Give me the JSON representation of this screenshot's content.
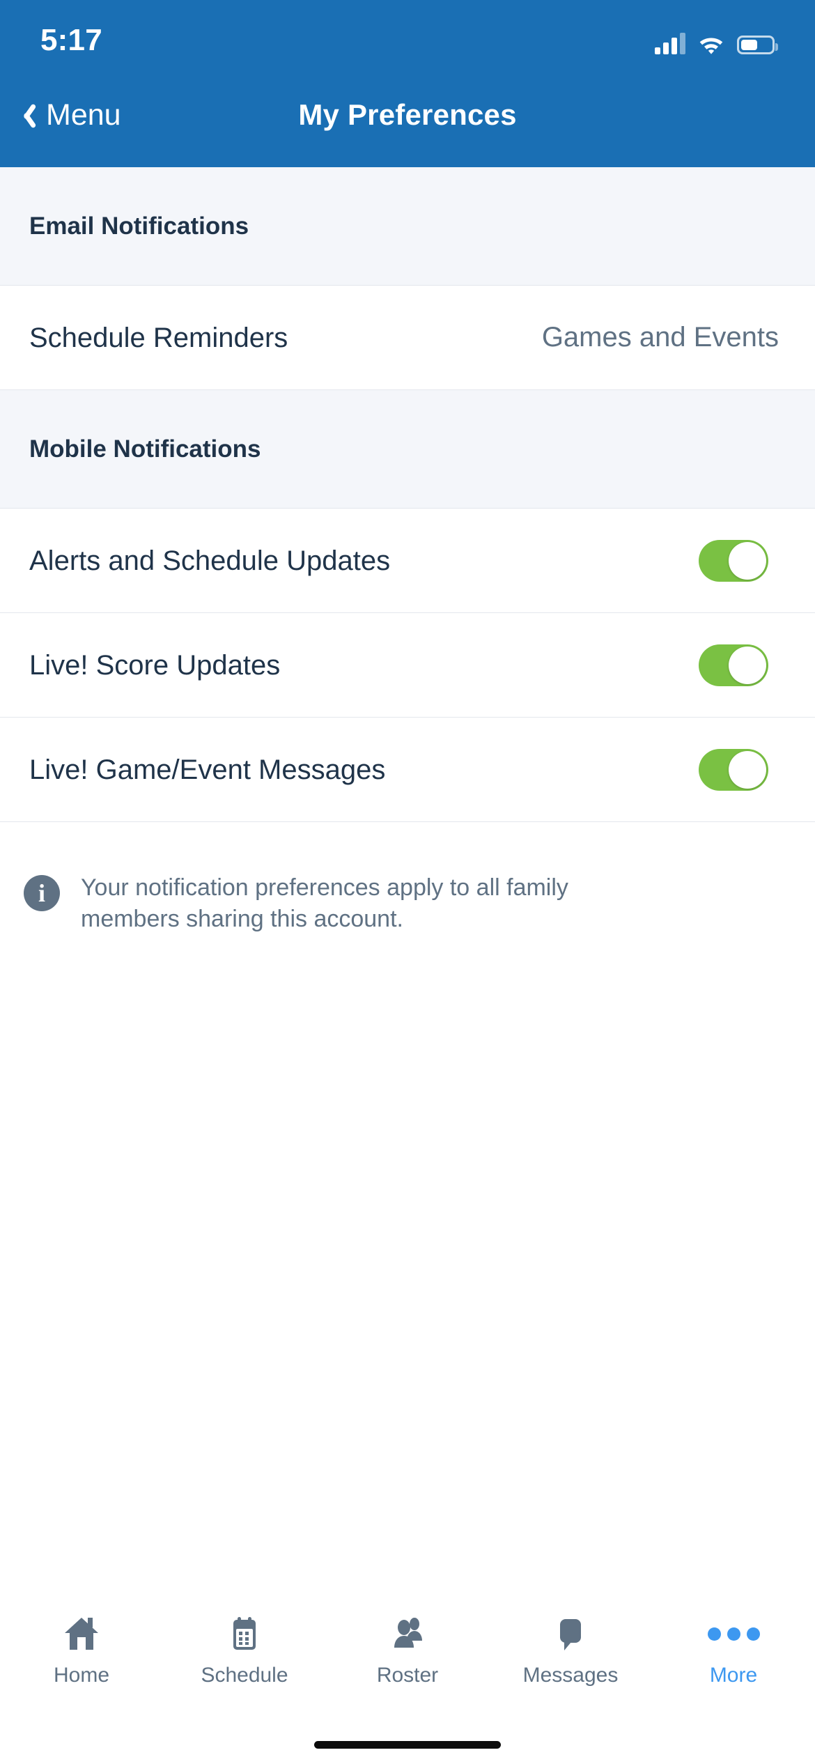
{
  "status_bar": {
    "time": "5:17",
    "icons": [
      "cellular-signal-icon",
      "wifi-icon",
      "battery-icon"
    ]
  },
  "nav_bar": {
    "back_label": "Menu",
    "back_icon": "chevron-left-icon",
    "title": "My Preferences"
  },
  "sections": [
    {
      "header": "Email Notifications",
      "rows": [
        {
          "label": "Schedule Reminders",
          "value": "Games and Events",
          "type": "value"
        }
      ]
    },
    {
      "header": "Mobile Notifications",
      "rows": [
        {
          "label": "Alerts and Schedule Updates",
          "type": "toggle",
          "on": true
        },
        {
          "label": "Live! Score Updates",
          "type": "toggle",
          "on": true
        },
        {
          "label": "Live! Game/Event Messages",
          "type": "toggle",
          "on": true
        }
      ]
    }
  ],
  "note": {
    "icon": "info-circle-icon",
    "text": "Your notification preferences apply to all family members sharing this account."
  },
  "tab_bar": {
    "tabs": [
      {
        "label": "Home",
        "icon": "home-icon",
        "active": false
      },
      {
        "label": "Schedule",
        "icon": "calendar-icon",
        "active": false
      },
      {
        "label": "Roster",
        "icon": "people-icon",
        "active": false
      },
      {
        "label": "Messages",
        "icon": "speech-bubble-icon",
        "active": false
      },
      {
        "label": "More",
        "icon": "ellipsis-icon",
        "active": true
      }
    ]
  },
  "colors": {
    "header_blue": "#1a6fb4",
    "toggle_green": "#7ac143",
    "accent_blue": "#3d98f0",
    "text_navy": "#1f3349",
    "text_gray": "#5f7183",
    "section_bg": "#f4f6fa"
  }
}
